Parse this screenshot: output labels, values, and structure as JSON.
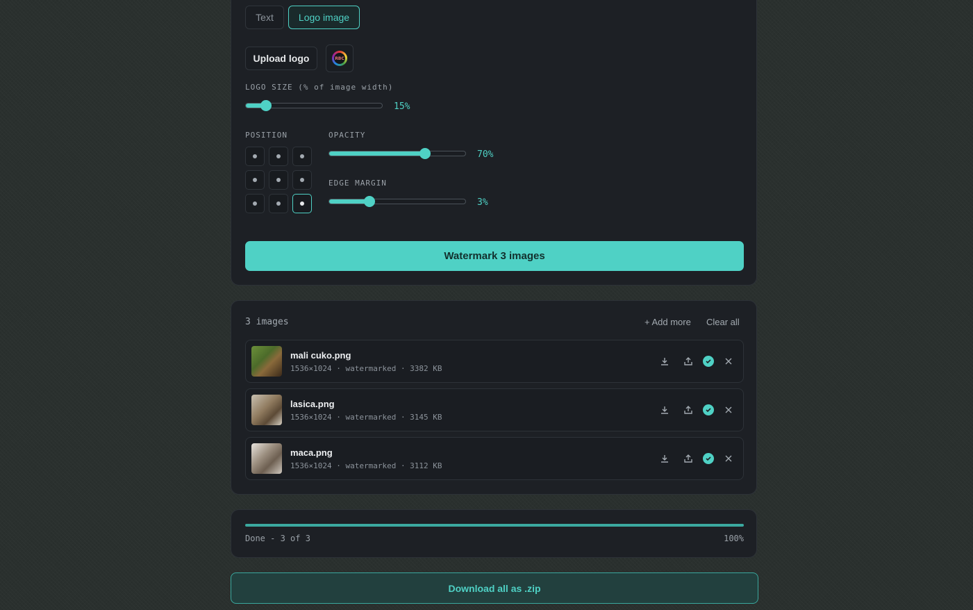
{
  "tabs": [
    {
      "label": "Text",
      "active": false
    },
    {
      "label": "Logo image",
      "active": true
    }
  ],
  "logo": {
    "upload_label": "Upload logo",
    "thumb_text": "RBC"
  },
  "logo_size": {
    "label": "LOGO SIZE (% of image width)",
    "value": "15%",
    "fraction": 0.15
  },
  "position": {
    "label": "POSITION",
    "selected": "bottom-right"
  },
  "opacity": {
    "label": "OPACITY",
    "value": "70%",
    "fraction": 0.7
  },
  "edge_margin": {
    "label": "EDGE MARGIN",
    "value": "3%",
    "fraction": 0.3
  },
  "watermark_button": "Watermark 3 images",
  "images": {
    "count_label": "3 images",
    "add_more": "+ Add more",
    "clear_all": "Clear all",
    "items": [
      {
        "name": "mali cuko.png",
        "meta": "1536×1024 · watermarked · 3382 KB"
      },
      {
        "name": "lasica.png",
        "meta": "1536×1024 · watermarked · 3145 KB"
      },
      {
        "name": "maca.png",
        "meta": "1536×1024 · watermarked · 3112 KB"
      }
    ]
  },
  "progress": {
    "status": "Done - 3 of 3",
    "percent_label": "100%",
    "fraction": 1.0
  },
  "download_zip": "Download all as .zip",
  "colors": {
    "accent": "#4fd1c5",
    "panel": "#1d2025",
    "background": "#2a302e"
  }
}
